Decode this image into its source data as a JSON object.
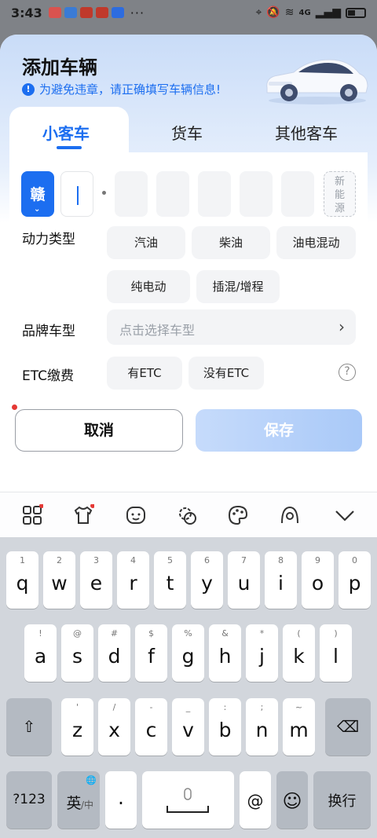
{
  "status_bar": {
    "time": "3:43",
    "more": "···",
    "network": "4G"
  },
  "header": {
    "title": "添加车辆",
    "notice": "为避免违章，请正确填写车辆信息!",
    "notice_icon": "!"
  },
  "tabs": [
    {
      "label": "小客车",
      "active": true
    },
    {
      "label": "货车",
      "active": false
    },
    {
      "label": "其他客车",
      "active": false
    }
  ],
  "plate": {
    "province": "赣",
    "new_energy_label": [
      "新",
      "能",
      "源"
    ],
    "chevron": "⌄"
  },
  "power_type": {
    "label": "动力类型",
    "options": [
      "汽油",
      "柴油",
      "油电混动",
      "纯电动",
      "插混/增程"
    ]
  },
  "model": {
    "label": "品牌车型",
    "placeholder": "点击选择车型",
    "arrow": "›"
  },
  "etc": {
    "label": "ETC缴费",
    "options": [
      "有ETC",
      "没有ETC"
    ],
    "help": "?"
  },
  "actions": {
    "cancel": "取消",
    "save": "保存"
  },
  "keyboard": {
    "row1": [
      {
        "sub": "1",
        "key": "q"
      },
      {
        "sub": "2",
        "key": "w"
      },
      {
        "sub": "3",
        "key": "e"
      },
      {
        "sub": "4",
        "key": "r"
      },
      {
        "sub": "5",
        "key": "t"
      },
      {
        "sub": "6",
        "key": "y"
      },
      {
        "sub": "7",
        "key": "u"
      },
      {
        "sub": "8",
        "key": "i"
      },
      {
        "sub": "9",
        "key": "o"
      },
      {
        "sub": "0",
        "key": "p"
      }
    ],
    "row2": [
      {
        "sub": "!",
        "key": "a"
      },
      {
        "sub": "@",
        "key": "s"
      },
      {
        "sub": "#",
        "key": "d"
      },
      {
        "sub": "$",
        "key": "f"
      },
      {
        "sub": "%",
        "key": "g"
      },
      {
        "sub": "&",
        "key": "h"
      },
      {
        "sub": "*",
        "key": "j"
      },
      {
        "sub": "(",
        "key": "k"
      },
      {
        "sub": ")",
        "key": "l"
      }
    ],
    "row3": [
      {
        "sub": "'",
        "key": "z"
      },
      {
        "sub": "/",
        "key": "x"
      },
      {
        "sub": "-",
        "key": "c"
      },
      {
        "sub": "_",
        "key": "v"
      },
      {
        "sub": ":",
        "key": "b"
      },
      {
        "sub": ";",
        "key": "n"
      },
      {
        "sub": "~",
        "key": "m"
      }
    ],
    "shift": "⇧",
    "backspace": "⌫",
    "numbers": "?123",
    "lang": "英",
    "lang_alt": "/中",
    "globe": "🌐",
    "period": "·",
    "at": "@",
    "emoji": "☺",
    "enter": "换行"
  },
  "colors": {
    "accent": "#1c6ef0",
    "required": "#e53935"
  }
}
